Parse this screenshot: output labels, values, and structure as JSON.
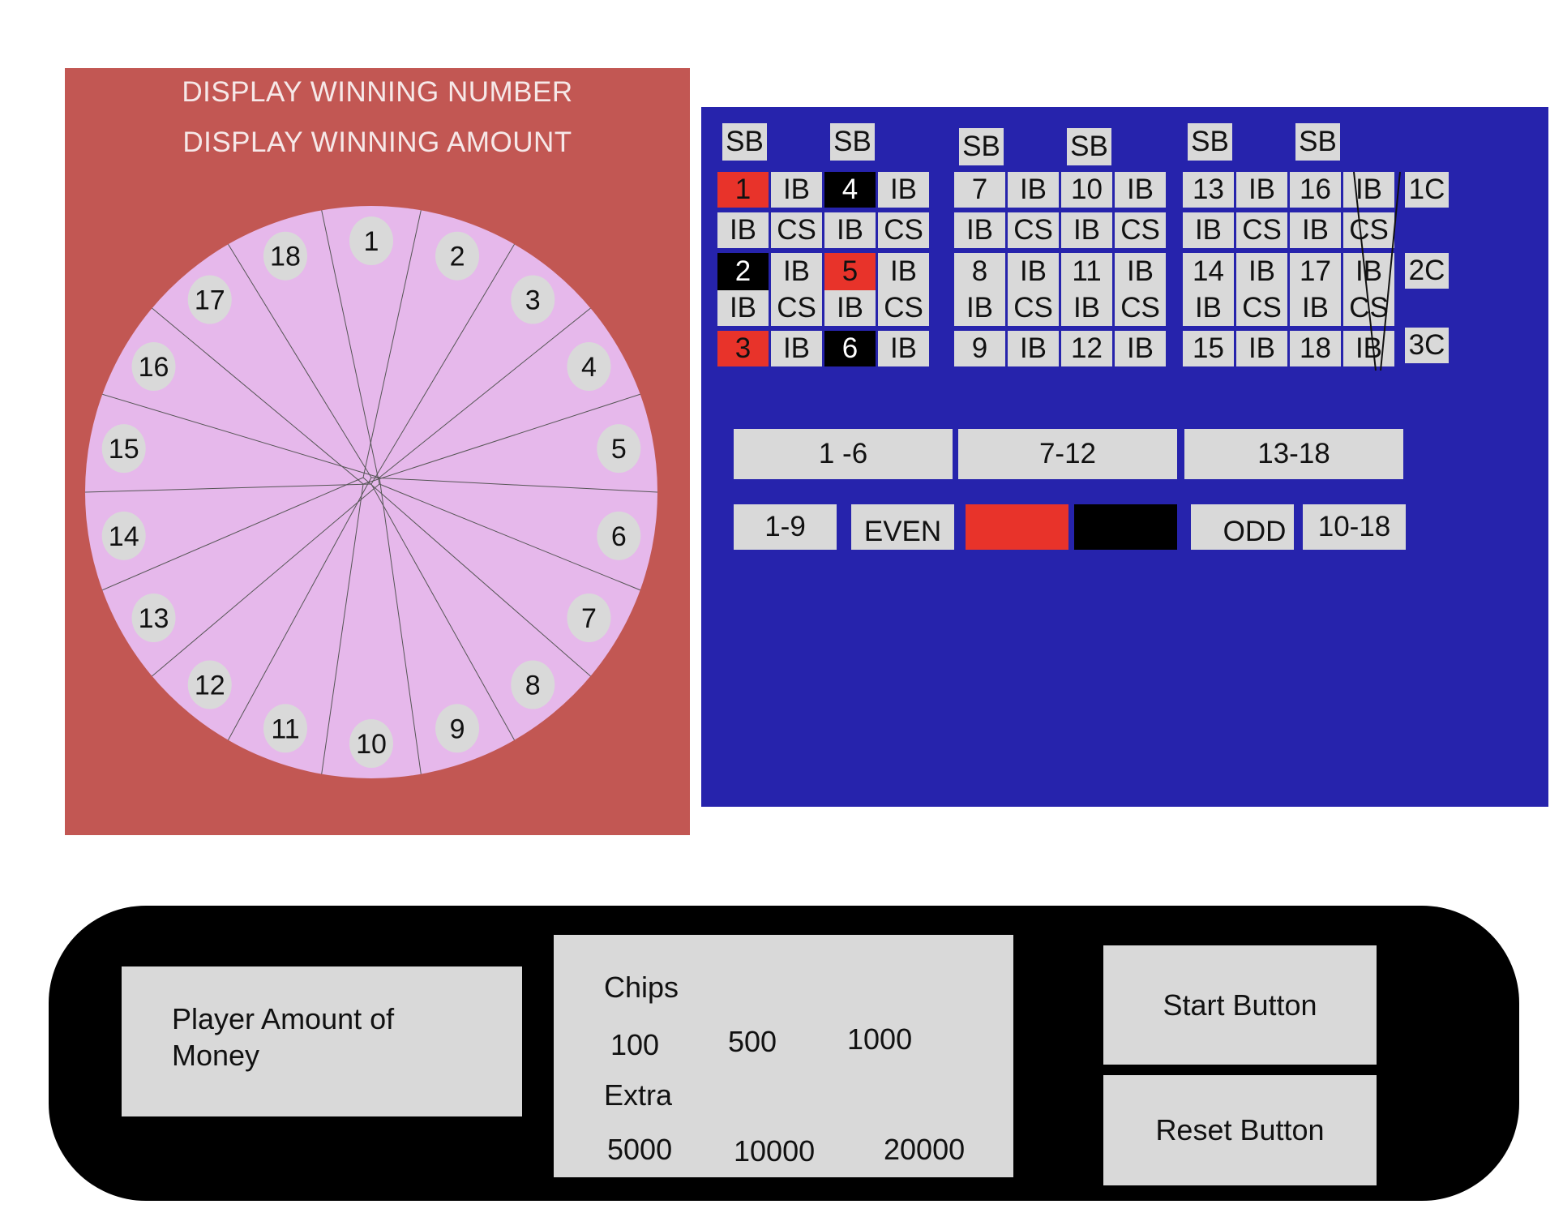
{
  "display": {
    "winning_number_label": "DISPLAY WINNING NUMBER",
    "winning_amount_label": "DISPLAY WINNING AMOUNT"
  },
  "wheel": {
    "numbers": [
      "1",
      "2",
      "3",
      "4",
      "5",
      "6",
      "7",
      "8",
      "9",
      "10",
      "11",
      "12",
      "13",
      "14",
      "15",
      "16",
      "17",
      "18"
    ],
    "colors": {
      "panel": "#c25753",
      "wheel": "#e6b8eb",
      "pocket": "#d9d9d9"
    }
  },
  "board": {
    "split_bet_label": "SB",
    "inside_bet_label": "IB",
    "corner_split_label": "CS",
    "numbers": [
      {
        "n": "1",
        "color": "red"
      },
      {
        "n": "2",
        "color": "black"
      },
      {
        "n": "3",
        "color": "red"
      },
      {
        "n": "4",
        "color": "black"
      },
      {
        "n": "5",
        "color": "red"
      },
      {
        "n": "6",
        "color": "black"
      },
      {
        "n": "7",
        "color": "grey"
      },
      {
        "n": "8",
        "color": "grey"
      },
      {
        "n": "9",
        "color": "grey"
      },
      {
        "n": "10",
        "color": "grey"
      },
      {
        "n": "11",
        "color": "grey"
      },
      {
        "n": "12",
        "color": "grey"
      },
      {
        "n": "13",
        "color": "grey"
      },
      {
        "n": "14",
        "color": "grey"
      },
      {
        "n": "15",
        "color": "grey"
      },
      {
        "n": "16",
        "color": "grey"
      },
      {
        "n": "17",
        "color": "grey"
      },
      {
        "n": "18",
        "color": "grey"
      }
    ],
    "columns": [
      "1C",
      "2C",
      "3C"
    ],
    "dozens": [
      "1 -6",
      "7-12",
      "13-18"
    ],
    "outside": {
      "low": "1-9",
      "even": "EVEN",
      "red_color": "#e8332a",
      "black_color": "#000000",
      "odd": "ODD",
      "high": "10-18"
    },
    "colors": {
      "background": "#2623ac",
      "cell": "#d9d9d9"
    }
  },
  "controls": {
    "player_money_label": "Player Amount of Money",
    "chips_label": "Chips",
    "chips": [
      "100",
      "500",
      "1000"
    ],
    "extra_label": "Extra",
    "extra_chips": [
      "5000",
      "10000",
      "20000"
    ],
    "start_button": "Start Button",
    "reset_button": "Reset Button"
  }
}
